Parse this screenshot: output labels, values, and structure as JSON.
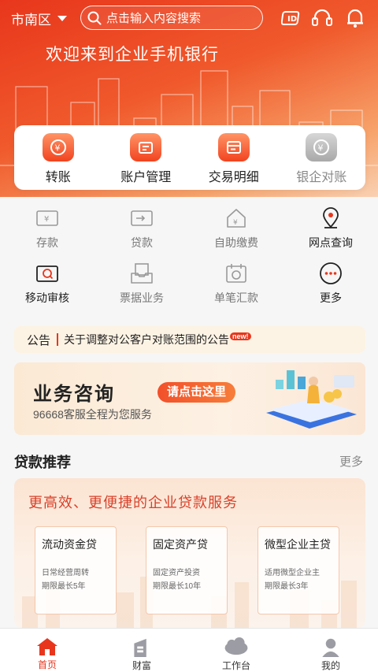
{
  "header": {
    "city": "市南区",
    "search_placeholder": "点击输入内容搜索",
    "welcome": "欢迎来到企业手机银行",
    "icons": [
      "scan-icon",
      "headset-icon",
      "bell-icon"
    ]
  },
  "quick_actions": [
    {
      "label": "转账",
      "icon": "transfer-icon",
      "enabled": true
    },
    {
      "label": "账户管理",
      "icon": "account-manage-icon",
      "enabled": true
    },
    {
      "label": "交易明细",
      "icon": "transaction-detail-icon",
      "enabled": true
    },
    {
      "label": "银企对账",
      "icon": "reconciliation-icon",
      "enabled": false
    }
  ],
  "grid_menu": [
    {
      "label": "存款",
      "icon": "deposit-icon"
    },
    {
      "label": "贷款",
      "icon": "loan-icon"
    },
    {
      "label": "自助缴费",
      "icon": "self-payment-icon"
    },
    {
      "label": "网点查询",
      "icon": "location-pin-icon"
    },
    {
      "label": "移动审核",
      "icon": "mobile-review-icon"
    },
    {
      "label": "票据业务",
      "icon": "bill-business-icon"
    },
    {
      "label": "单笔汇款",
      "icon": "single-remittance-icon"
    },
    {
      "label": "更多",
      "icon": "more-icon"
    }
  ],
  "notice": {
    "tag": "公告",
    "text": "关于调整对公客户对账范围的公告",
    "badge": "new!"
  },
  "consult": {
    "title": "业务咨询",
    "cta": "请点击这里",
    "subtitle": "96668客服全程为您服务"
  },
  "loans": {
    "section_title": "贷款推荐",
    "more": "更多",
    "headline": "更高效、更便捷的企业贷款服务",
    "items": [
      {
        "name": "流动资金贷",
        "desc1": "日常经营周转",
        "desc2": "期限最长5年"
      },
      {
        "name": "固定资产贷",
        "desc1": "固定资产投资",
        "desc2": "期限最长10年"
      },
      {
        "name": "微型企业主贷",
        "desc1": "适用微型企业主",
        "desc2": "期限最长3年"
      }
    ]
  },
  "tabbar": [
    {
      "label": "首页",
      "icon": "home-icon",
      "active": true
    },
    {
      "label": "财富",
      "icon": "wealth-icon",
      "active": false
    },
    {
      "label": "工作台",
      "icon": "workbench-icon",
      "active": false
    },
    {
      "label": "我的",
      "icon": "profile-icon",
      "active": false
    }
  ],
  "colors": {
    "brand": "#e8361c",
    "accent": "#f77d3a",
    "notice_bg": "#fdf3e4"
  }
}
